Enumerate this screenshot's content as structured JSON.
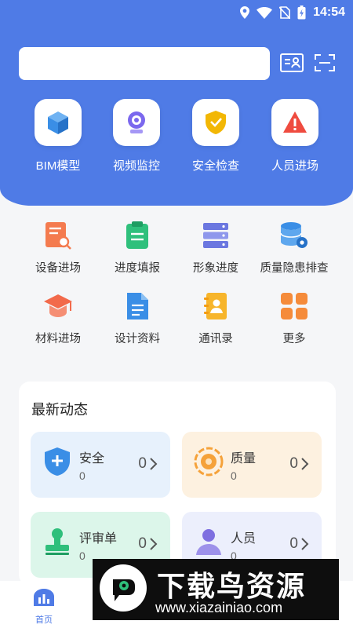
{
  "status_bar": {
    "time": "14:54",
    "icons": [
      "location-icon",
      "wifi-icon",
      "no-sim-icon",
      "battery-charging-icon"
    ]
  },
  "header": {
    "search": {
      "value": "",
      "placeholder": ""
    },
    "icons": [
      "id-card-icon",
      "scan-icon"
    ]
  },
  "quick_actions": [
    {
      "label": "BIM模型",
      "icon": "cube-icon",
      "color": "#3a8ee6"
    },
    {
      "label": "视频监控",
      "icon": "webcam-icon",
      "color": "#7b68ee"
    },
    {
      "label": "安全检查",
      "icon": "shield-check-icon",
      "color": "#f2b705"
    },
    {
      "label": "人员进场",
      "icon": "warning-icon",
      "color": "#ef4b3f"
    }
  ],
  "functions": [
    {
      "label": "设备进场",
      "icon": "equipment-doc-icon",
      "color": "#f47b4f"
    },
    {
      "label": "进度填报",
      "icon": "clipboard-icon",
      "color": "#2fc07c"
    },
    {
      "label": "形象进度",
      "icon": "server-icon",
      "color": "#6b77e0"
    },
    {
      "label": "质量隐患排查",
      "icon": "database-gear-icon",
      "color": "#3a8ee6"
    },
    {
      "label": "材料进场",
      "icon": "graduation-cap-icon",
      "color": "#f26a4b"
    },
    {
      "label": "设计资料",
      "icon": "document-icon",
      "color": "#3a8ee6"
    },
    {
      "label": "通讯录",
      "icon": "contacts-icon",
      "color": "#f7b52b"
    },
    {
      "label": "更多",
      "icon": "more-grid-icon",
      "color": "#f58b3a"
    }
  ],
  "news": {
    "title": "最新动态",
    "cards": [
      {
        "name": "安全",
        "count": "0",
        "number": "0",
        "icon": "shield-plus-icon",
        "bg": "#e7f1fc",
        "accent": "#3a8ee6"
      },
      {
        "name": "质量",
        "count": "0",
        "number": "0",
        "icon": "target-icon",
        "bg": "#fdf1e0",
        "accent": "#f5a23a"
      },
      {
        "name": "评审单",
        "count": "0",
        "number": "0",
        "icon": "stamp-icon",
        "bg": "#dcf6ea",
        "accent": "#2fbf7b"
      },
      {
        "name": "人员",
        "count": "0",
        "number": "0",
        "icon": "person-icon",
        "bg": "#eceffc",
        "accent": "#7e6fe0"
      }
    ]
  },
  "tabbar": {
    "home_label": "首页"
  },
  "watermark": {
    "title": "下载鸟资源",
    "url": "www.xiazainiao.com"
  },
  "colors": {
    "primary": "#4f7be6",
    "background": "#f5f6f8"
  }
}
